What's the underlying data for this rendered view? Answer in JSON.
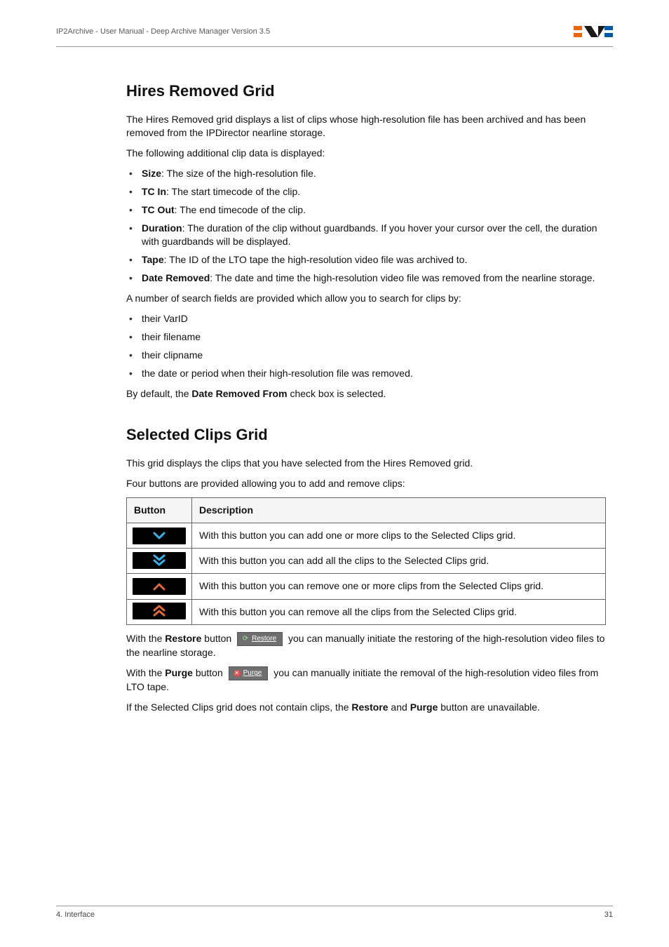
{
  "header": {
    "title": "IP2Archive - User Manual - Deep Archive Manager Version 3.5",
    "logo_alt": "EVS"
  },
  "sections": {
    "hires": {
      "heading": "Hires Removed Grid",
      "intro": "The Hires Removed grid displays a list of clips whose high-resolution file has been archived and has been removed from the IPDirector nearline storage.",
      "intro2": "The following additional clip data is displayed:",
      "fields": [
        {
          "label": "Size",
          "desc": ": The size of the high-resolution file."
        },
        {
          "label": "TC In",
          "desc": ": The start timecode of the clip."
        },
        {
          "label": "TC Out",
          "desc": ": The end timecode of the clip."
        },
        {
          "label": "Duration",
          "desc": ": The duration of the clip without guardbands. If you hover your cursor over the cell, the duration with guardbands will be displayed."
        },
        {
          "label": "Tape",
          "desc": ": The ID of the LTO tape the high-resolution video file was archived to."
        },
        {
          "label": "Date Removed",
          "desc": ": The date and time the high-resolution video file was removed from the nearline storage."
        }
      ],
      "search_intro": "A number of search fields are provided which allow you to search for clips by:",
      "search_items": [
        "their VarID",
        "their filename",
        "their clipname",
        "the date or period when their high-resolution file was removed."
      ],
      "default_pre": "By default, the ",
      "default_bold": "Date Removed From",
      "default_post": " check box is selected."
    },
    "selected": {
      "heading": "Selected Clips Grid",
      "intro": "This grid displays the clips that you have selected from the Hires Removed grid.",
      "intro2": "Four buttons are provided allowing you to add and remove clips:",
      "table": {
        "col_button": "Button",
        "col_desc": "Description",
        "rows": [
          {
            "icon": "chevron-down-icon",
            "desc": "With this button you can add one or more clips to the Selected Clips grid."
          },
          {
            "icon": "double-chevron-down-icon",
            "desc": "With this button you can add all the clips to the Selected Clips grid."
          },
          {
            "icon": "chevron-up-icon",
            "desc": "With this button you can remove one or more clips from the Selected Clips grid."
          },
          {
            "icon": "double-chevron-up-icon",
            "desc": "With this button you can remove all the clips from the Selected Clips grid."
          }
        ]
      },
      "restore": {
        "pre": "With the ",
        "bold": "Restore",
        "mid": " button ",
        "btn_label": "Restore",
        "post": " you can manually initiate the restoring of the high-resolution video files to the nearline storage."
      },
      "purge": {
        "pre": "With the ",
        "bold": "Purge",
        "mid": " button ",
        "btn_label": "Purge",
        "post": " you can manually initiate the removal of the high-resolution video files from LTO tape."
      },
      "unavailable": {
        "pre": "If the Selected Clips grid does not contain clips, the ",
        "b1": "Restore",
        "mid": " and ",
        "b2": "Purge",
        "post": " button are unavailable."
      }
    }
  },
  "footer": {
    "section": "4. Interface",
    "page": "31"
  }
}
